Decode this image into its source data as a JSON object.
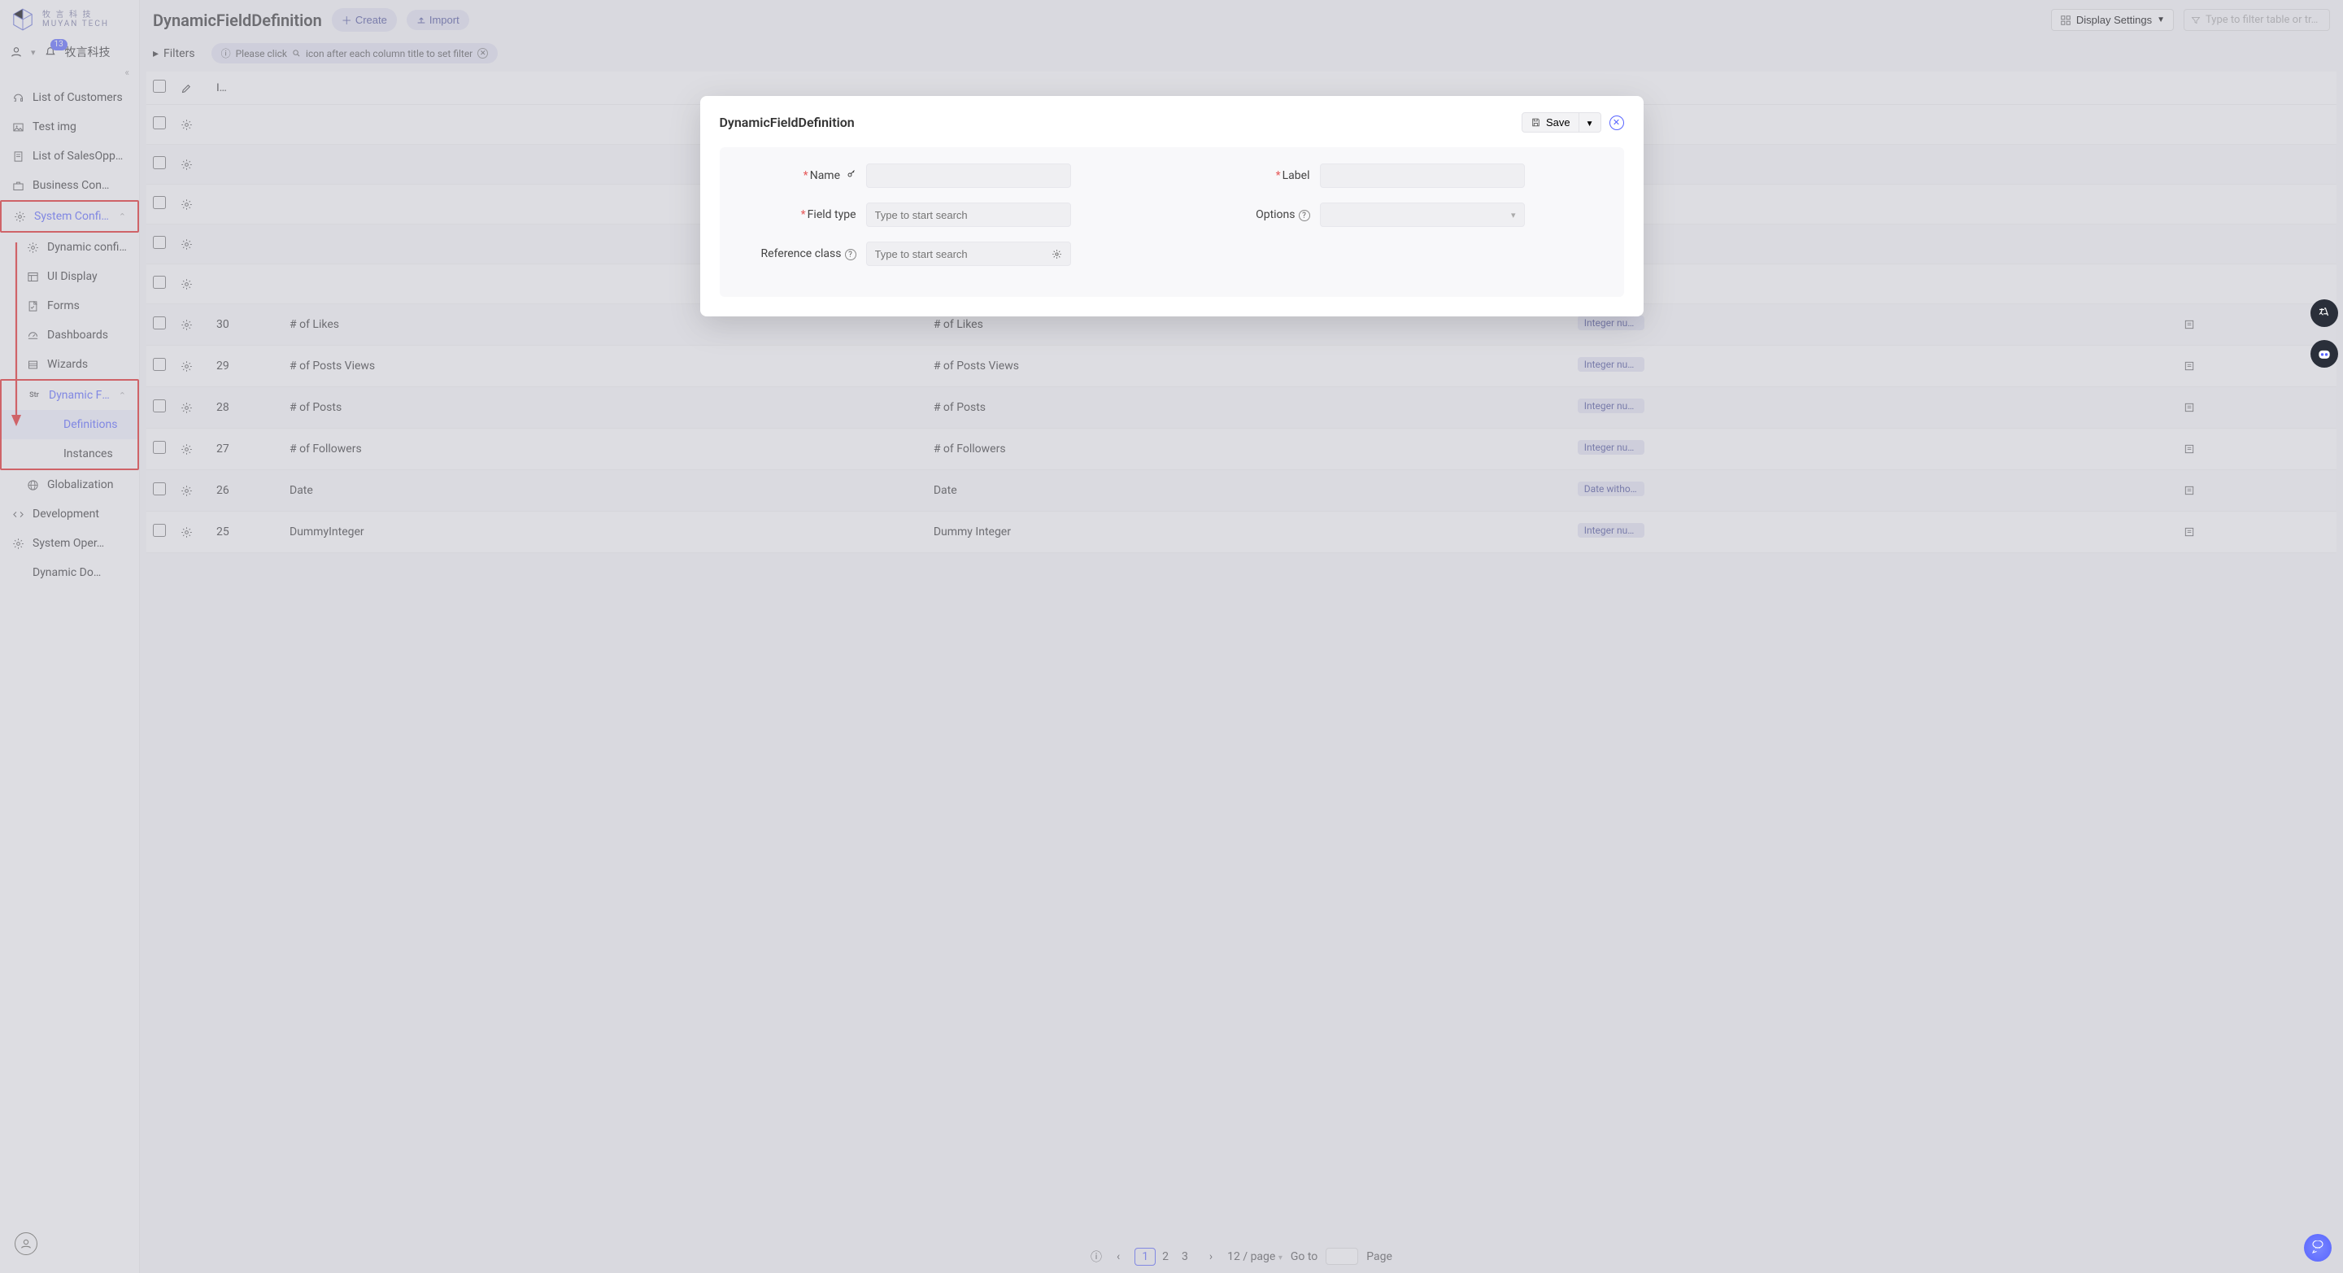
{
  "logo": {
    "line1": "牧 言 科 技",
    "line2": "MUYAN TECH"
  },
  "user": {
    "badge": "13",
    "org": "牧言科技"
  },
  "sidebar": {
    "items": [
      {
        "icon": "headset",
        "label": "List of Customers"
      },
      {
        "icon": "image",
        "label": "Test img"
      },
      {
        "icon": "doc",
        "label": "List of SalesOpp…"
      },
      {
        "icon": "briefcase",
        "label": "Business Con…"
      },
      {
        "icon": "gear",
        "label": "System Confi…",
        "expandable": true,
        "accent": true,
        "red": true
      },
      {
        "icon": "gear",
        "label": "Dynamic configs",
        "level": 2
      },
      {
        "icon": "layout",
        "label": "UI Display",
        "level": 2
      },
      {
        "icon": "form",
        "label": "Forms",
        "level": 2
      },
      {
        "icon": "dash",
        "label": "Dashboards",
        "level": 2
      },
      {
        "icon": "wizard",
        "label": "Wizards",
        "level": 2
      },
      {
        "icon": "str",
        "label": "Dynamic Field",
        "level": 2,
        "expandable": true,
        "accent": true,
        "red_group_start": true
      },
      {
        "icon": "",
        "label": "Definitions",
        "level": 3,
        "active": true
      },
      {
        "icon": "",
        "label": "Instances",
        "level": 3,
        "red_group_end": true
      },
      {
        "icon": "globe",
        "label": "Globalization",
        "level": 2
      },
      {
        "icon": "code",
        "label": "Development"
      },
      {
        "icon": "gear",
        "label": "System Oper…"
      },
      {
        "icon": "",
        "label": "Dynamic Do…"
      }
    ]
  },
  "header": {
    "title": "DynamicFieldDefinition",
    "create": "Create",
    "import": "Import",
    "display_settings": "Display Settings",
    "filter_placeholder": "Type to filter table or tr…"
  },
  "subheader": {
    "filters": "Filters",
    "hint_pre": "Please click",
    "hint_post": "icon after each column title to set filter"
  },
  "table": {
    "rows": [
      {
        "id": "30",
        "name": "# of Likes",
        "label": "# of Likes",
        "type": "Integer numb…"
      },
      {
        "id": "29",
        "name": "# of Posts Views",
        "label": "# of Posts Views",
        "type": "Integer numb…"
      },
      {
        "id": "28",
        "name": "# of Posts",
        "label": "# of Posts",
        "type": "Integer numb…"
      },
      {
        "id": "27",
        "name": "# of Followers",
        "label": "# of Followers",
        "type": "Integer numb…"
      },
      {
        "id": "26",
        "name": "Date",
        "label": "Date",
        "type": "Date without …"
      },
      {
        "id": "25",
        "name": "DummyInteger",
        "label": "Dummy Integer",
        "type": "Integer numb…"
      }
    ]
  },
  "pager": {
    "pages": [
      "1",
      "2",
      "3"
    ],
    "per_page": "12 / page",
    "goto": "Go to",
    "page_suffix": "Page"
  },
  "modal": {
    "title": "DynamicFieldDefinition",
    "save": "Save",
    "fields": {
      "name": "Name",
      "label": "Label",
      "field_type": "Field type",
      "options": "Options",
      "reference_class": "Reference class",
      "search_placeholder": "Type to start search"
    }
  }
}
